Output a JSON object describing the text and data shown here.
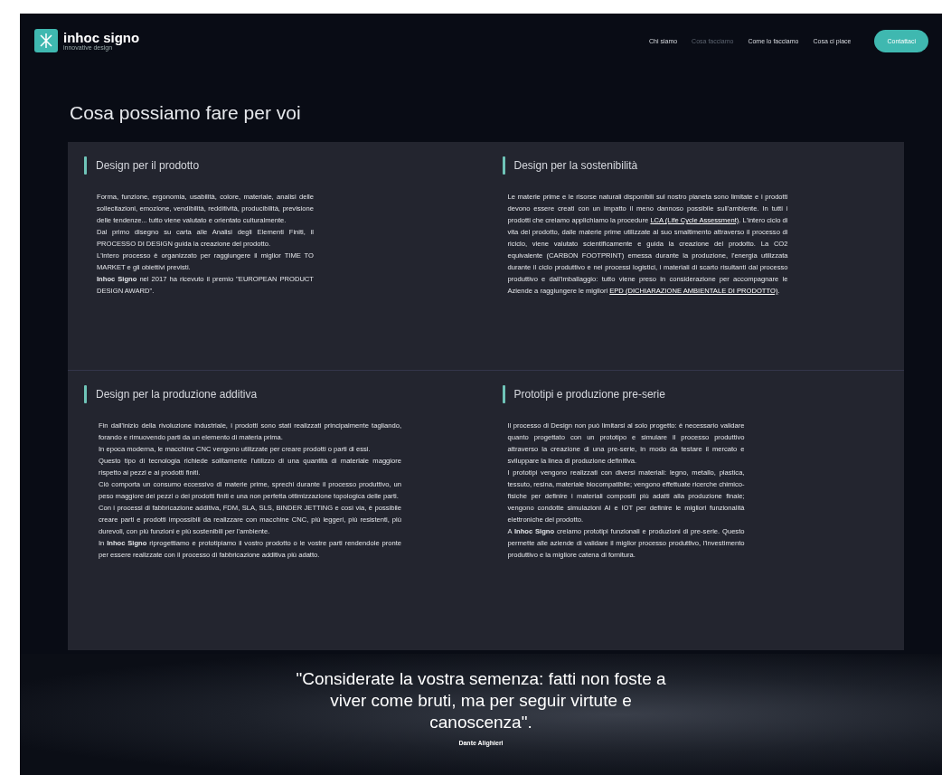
{
  "header": {
    "logo": {
      "name": "inhoc signo",
      "tagline": "innovative design"
    },
    "nav": [
      {
        "label": "Chi siamo",
        "selected": false
      },
      {
        "label": "Cosa facciamo",
        "selected": true
      },
      {
        "label": "Come lo facciamo",
        "selected": false
      },
      {
        "label": "Cosa ci piace",
        "selected": false
      }
    ],
    "cta": "Contattaci"
  },
  "title": "Cosa possiamo fare per voi",
  "cards": [
    {
      "title": "Design per il prodotto",
      "paragraphs": [
        [
          {
            "kind": "text",
            "text": "Forma, funzione, ergonomia, usabilità, colore, materiale, analisi delle sollecitazioni, emozione, vendibilità, redditività, producibilità, previsione delle tendenze... tutto viene valutato e orientato culturalmente."
          }
        ],
        [
          {
            "kind": "text",
            "text": "Dal primo disegno su carta alle Analisi degli Elementi Finiti, il PROCESSO DI DESIGN guida la creazione del prodotto."
          }
        ],
        [
          {
            "kind": "text",
            "text": "L'intero processo è organizzato per raggiungere il miglior TIME TO MARKET e gli obiettivi previsti."
          }
        ],
        [
          {
            "kind": "text",
            "text": "**Inhoc Signo** nel 2017 ha ricevuto il premio \"EUROPEAN PRODUCT DESIGN AWARD\"."
          }
        ]
      ]
    },
    {
      "title": "Design per la sostenibilità",
      "paragraphs": [
        [
          {
            "kind": "text",
            "text": "Le materie prime e le risorse naturali disponibili sul nostro pianeta sono limitate e i prodotti devono essere creati con un impatto il meno dannoso possibile sull'ambiente. In tutti i prodotti che creiamo applichiamo la procedure "
          },
          {
            "kind": "link",
            "text": "LCA (Life Cycle Assessment)"
          },
          {
            "kind": "text",
            "text": ". L'intero ciclo di vita del prodotto, dalle materie prime utilizzate al suo smaltimento attraverso il processo di riciclo, viene valutato scientificamente e guida la creazione del prodotto. La CO2 equivalente (CARBON FOOTPRINT) emessa durante la produzione, l'energia utilizzata durante il ciclo produttivo e nei processi logistici, i materiali di scarto risultanti dal processo produttivo e dall'imballaggio: tutto viene preso in considerazione per accompagnare le Aziende a raggiungere le migliori "
          },
          {
            "kind": "link",
            "text": "EPD (DICHIARAZIONE AMBIENTALE DI PRODOTTO)"
          },
          {
            "kind": "text",
            "text": "."
          }
        ]
      ]
    },
    {
      "title": "Design per la produzione additiva",
      "paragraphs": [
        [
          {
            "kind": "text",
            "text": "Fin dall'inizio della rivoluzione industriale, i prodotti sono stati realizzati principalmente tagliando, forando e rimuovendo parti da un elemento di materia prima."
          }
        ],
        [
          {
            "kind": "text",
            "text": "In epoca moderna, le macchine CNC vengono utilizzate per creare prodotti o parti di essi."
          }
        ],
        [
          {
            "kind": "text",
            "text": "Questo tipo di tecnologia richiede solitamente l'utilizzo di una quantità di materiale maggiore rispetto ai pezzi e ai prodotti finiti."
          }
        ],
        [
          {
            "kind": "text",
            "text": "Ciò comporta un consumo eccessivo di materie prime, sprechi durante il processo produttivo, un peso maggiore dei pezzi o dei prodotti finiti e una non perfetta ottimizzazione topologica delle parti."
          }
        ],
        [
          {
            "kind": "text",
            "text": "Con i processi di fabbricazione additiva, FDM, SLA, SLS, BINDER JETTING e così via, è possibile creare parti e prodotti impossibili da realizzare con macchine CNC, più leggeri, più resistenti, più durevoli, con più funzioni e più sostenibili per l'ambiente."
          }
        ],
        [
          {
            "kind": "text",
            "text": "In **Inhoc Signo** riprogettiamo e prototipiamo il vostro prodotto o le vostre parti rendendole pronte per essere realizzate con il processo di fabbricazione additiva più adatto."
          }
        ]
      ]
    },
    {
      "title": "Prototipi e produzione pre-serie",
      "paragraphs": [
        [
          {
            "kind": "text",
            "text": "Il processo di Design non può limitarsi al solo progetto: è necessario validare quanto progettato con un prototipo e simulare il processo produttivo attraverso la creazione di una pre-serie, in modo da testare il mercato e sviluppare la linea di produzione definitiva."
          }
        ],
        [
          {
            "kind": "text",
            "text": "I prototipi vengono realizzati con diversi materiali: legno, metallo, plastica, tessuto, resina, materiale biocompatibile; vengono effettuate ricerche chimico-fisiche per definire i materiali compositi più adatti alla produzione finale; vengono condotte simulazioni AI e IOT per definire le migliori funzionalità elettroniche del prodotto."
          }
        ],
        [
          {
            "kind": "text",
            "text": "A **Inhoc Signo** creiamo prototipi funzionali e produzioni di pre-serie. Questo permette alle aziende di validare il miglior processo produttivo, l'investimento produttivo e la migliore catena di fornitura."
          }
        ]
      ]
    }
  ],
  "quote": {
    "text": "\"Considerate la vostra semenza: fatti non foste a viver come bruti, ma per seguir virtute e canoscenza\".",
    "author": "Dante Alighieri"
  }
}
